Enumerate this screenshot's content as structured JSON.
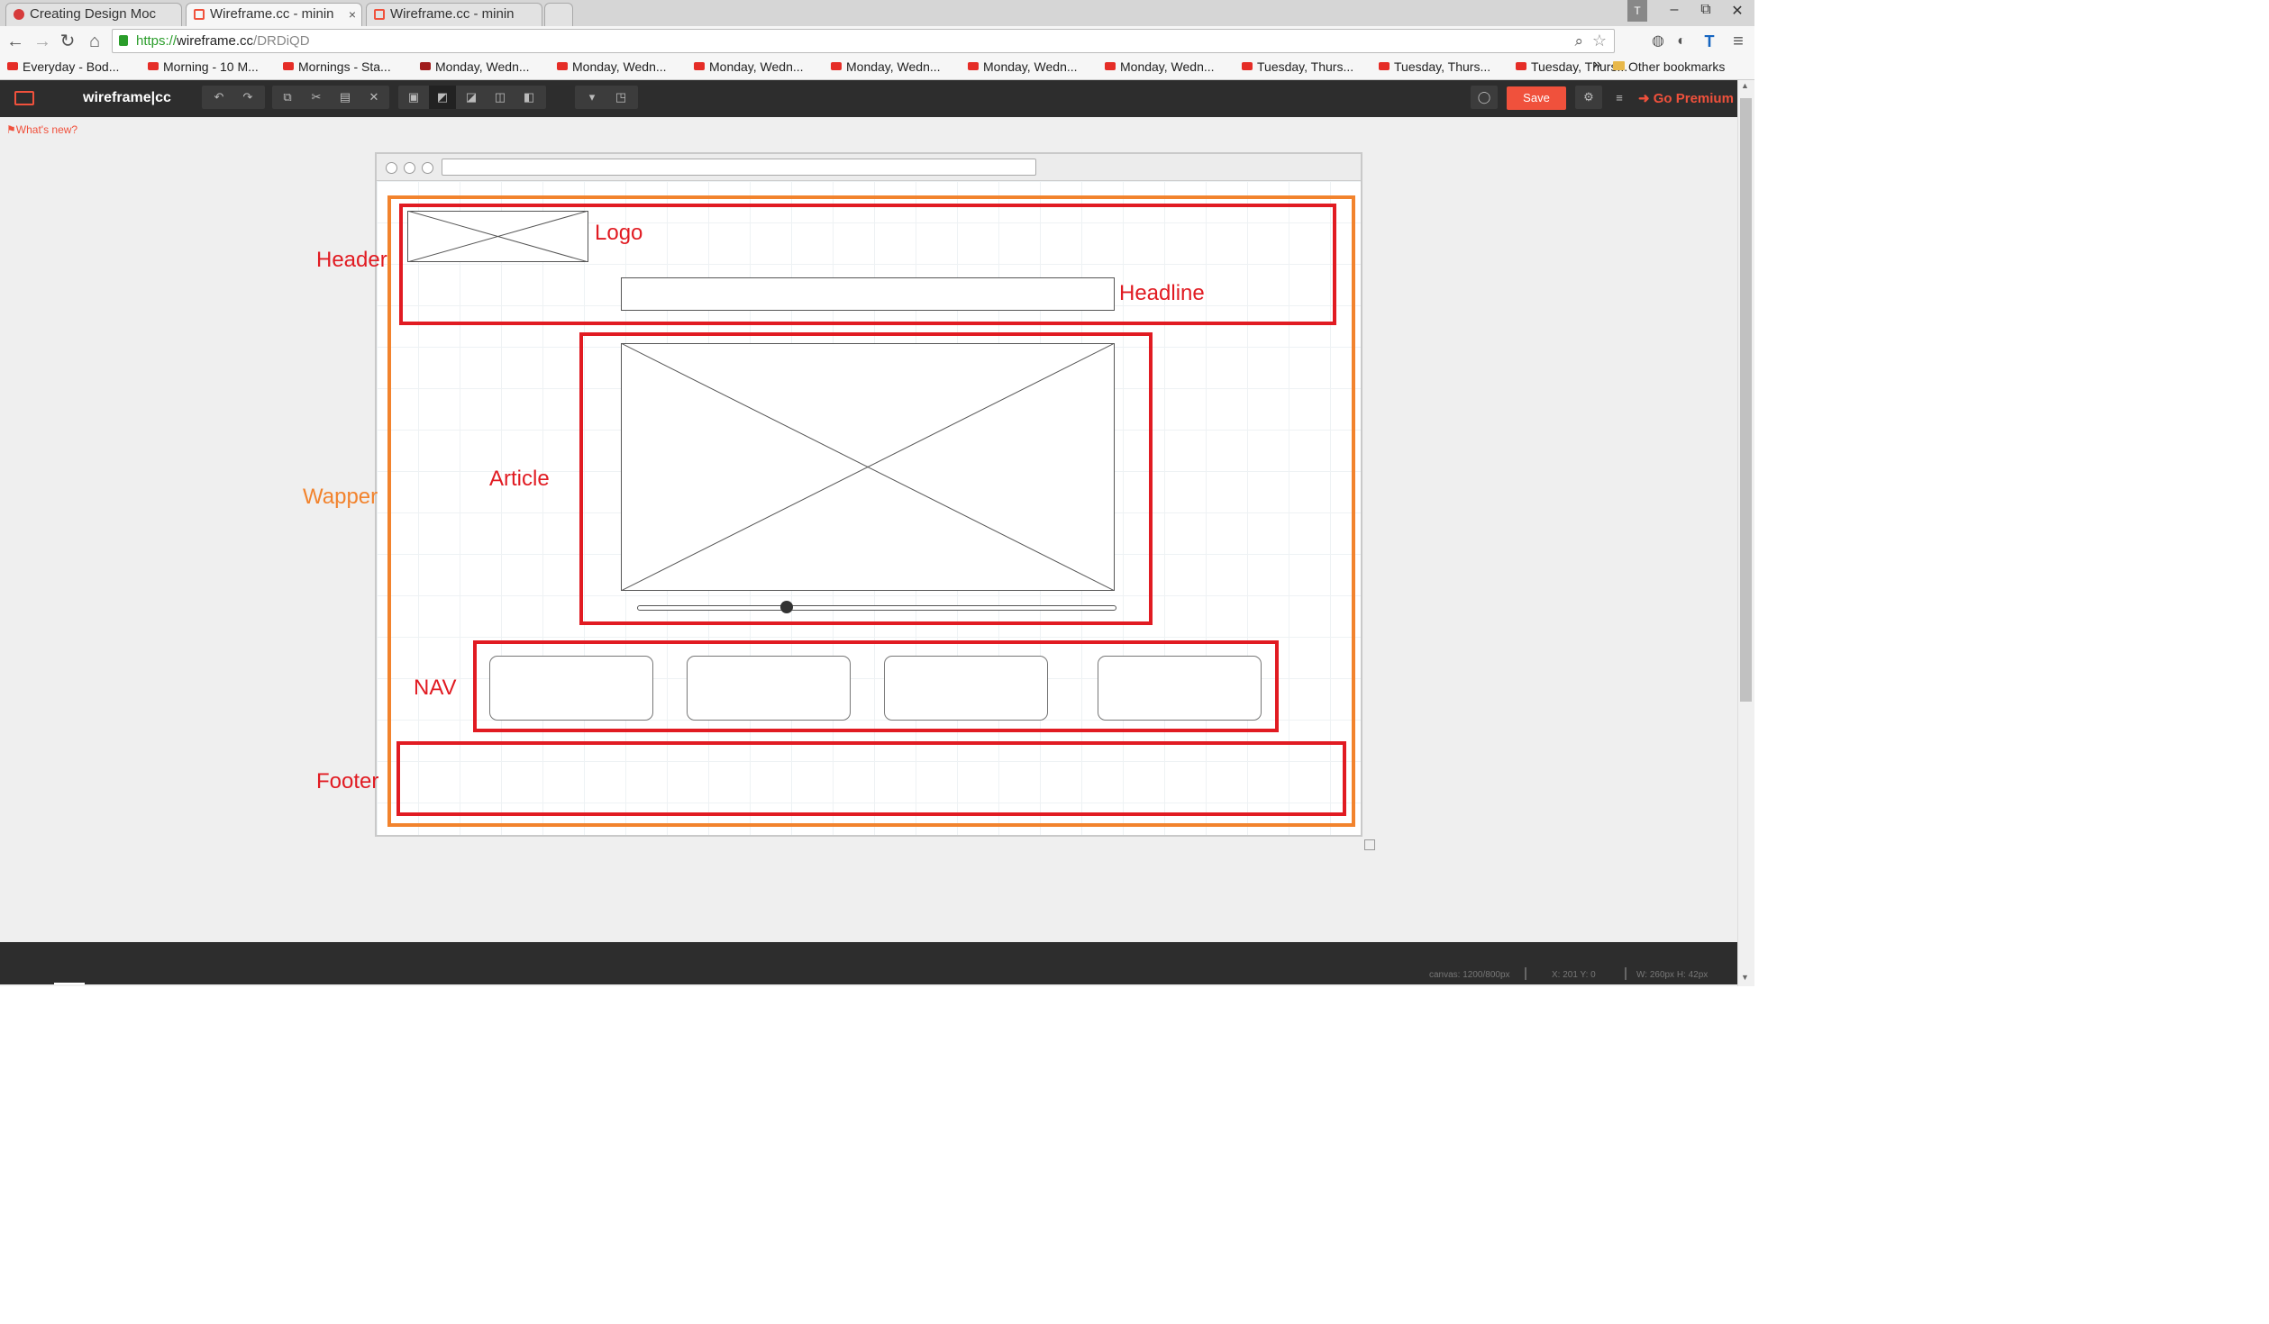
{
  "browser": {
    "tabs": [
      {
        "title": "Creating Design Moc",
        "active": false
      },
      {
        "title": "Wireframe.cc - minin",
        "active": true
      },
      {
        "title": "Wireframe.cc - minin",
        "active": false
      }
    ],
    "url_secure": "https://",
    "url_host": "wireframe.cc",
    "url_path": "/DRDiQD",
    "bookmarks": [
      "Everyday - Bod...",
      "Morning - 10 M...",
      "Mornings - Sta...",
      "Monday, Wedn...",
      "Monday, Wedn...",
      "Monday, Wedn...",
      "Monday, Wedn...",
      "Monday, Wedn...",
      "Monday, Wedn...",
      "Tuesday, Thurs...",
      "Tuesday, Thurs...",
      "Tuesday, Thurs..."
    ],
    "bookmarks_overflow": "»",
    "other_bookmarks": "Other bookmarks"
  },
  "app": {
    "logo": "wireframe|cc",
    "save_label": "Save",
    "premium_label": "Go Premium",
    "whats_new": "What's new?",
    "status": {
      "canvas": "canvas: 1200/800px",
      "xy": "X: 201 Y: 0",
      "wh": "W: 260px H: 42px"
    }
  },
  "annotations": {
    "header": "Header",
    "logo": "Logo",
    "headline": "Headline",
    "wrapper": "Wapper",
    "article": "Article",
    "nav": "NAV",
    "footer": "Footer"
  },
  "colors": {
    "annotation_red": "#e11b22",
    "annotation_orange": "#f2832d",
    "save_button": "#f0513c",
    "toolbar_bg": "#2d2d2d"
  },
  "icons": [
    "back-arrow-icon",
    "forward-arrow-icon",
    "reload-icon",
    "home-icon",
    "lock-icon",
    "search-icon",
    "star-icon",
    "menu-icon",
    "undo-icon",
    "redo-icon",
    "copy-icon",
    "cut-icon",
    "paste-icon",
    "delete-icon",
    "lock-tool-icon",
    "comment-icon",
    "settings-icon",
    "hamburger-icon",
    "resize-handle-icon"
  ]
}
